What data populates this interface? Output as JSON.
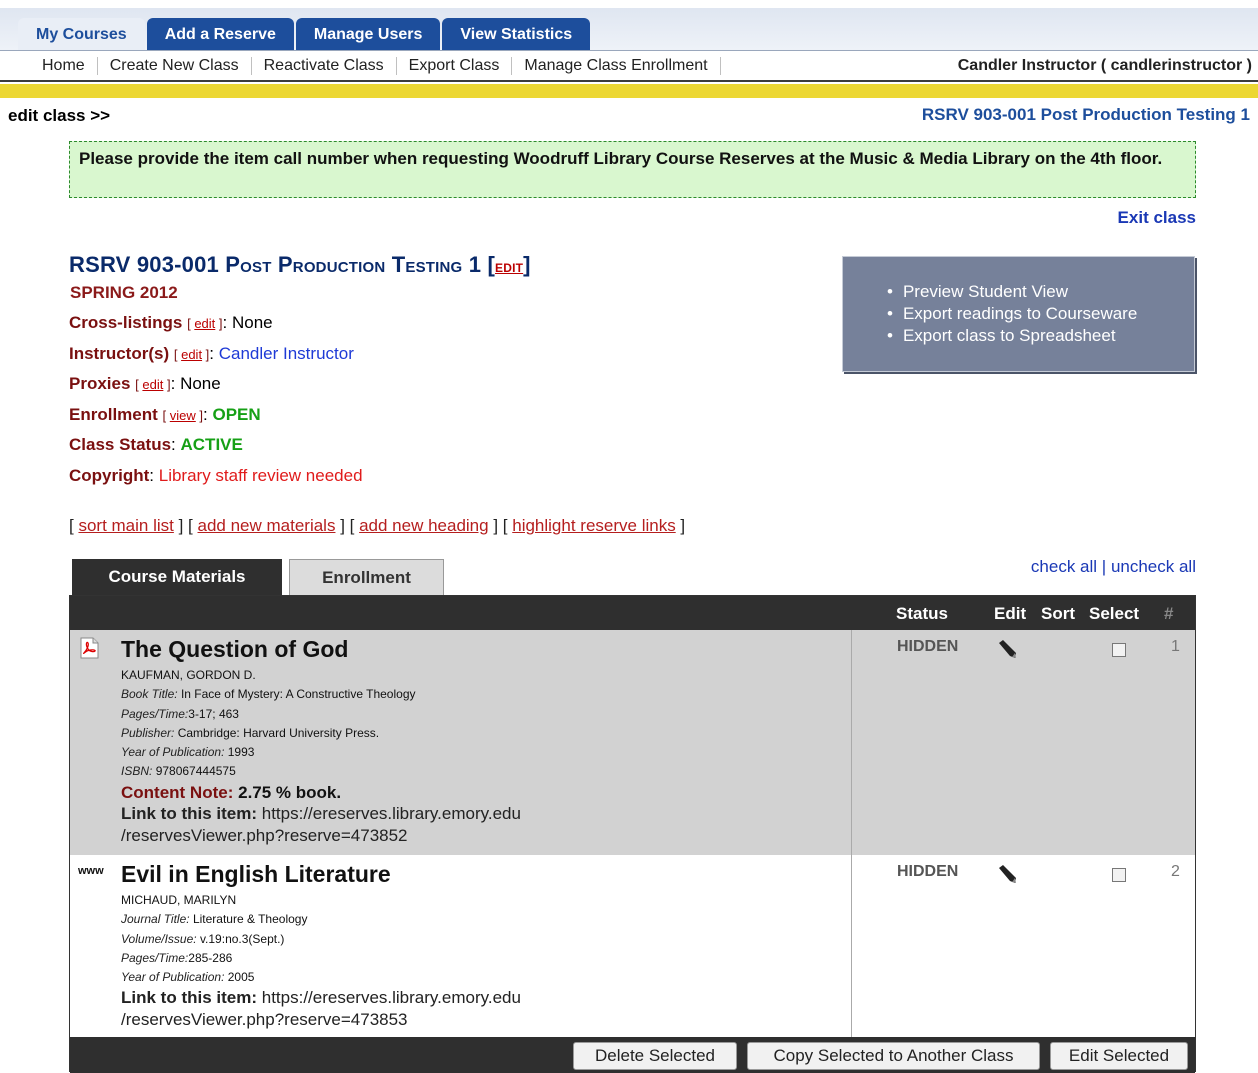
{
  "top_tabs": [
    "My Courses",
    "Add a Reserve",
    "Manage Users",
    "View Statistics"
  ],
  "subnav": [
    "Home",
    "Create New Class",
    "Reactivate Class",
    "Export Class",
    "Manage Class Enrollment"
  ],
  "user": "Candler Instructor ( candlerinstructor )",
  "breadcrumb": "edit class >>",
  "class_header_right": "RSRV 903-001 Post Production Testing 1",
  "notice": "Please provide the item call number when requesting Woodruff Library Course Reserves at the Music & Media Library on the 4th floor.",
  "exit_label": "Exit class",
  "course": {
    "title": "RSRV 903-001 Post Production Testing 1",
    "edit_bracket_open": "[",
    "edit_label": "EDIT",
    "edit_bracket_close": "]",
    "term": "SPRING 2012",
    "crosslistings_label": "Cross-listings",
    "crosslistings_edit": "edit",
    "crosslistings_value": "None",
    "instructors_label": "Instructor(s)",
    "instructors_edit": "edit",
    "instructors_value": "Candler Instructor",
    "proxies_label": "Proxies",
    "proxies_edit": "edit",
    "proxies_value": "None",
    "enrollment_label": "Enrollment",
    "enrollment_view": "view",
    "enrollment_value": "OPEN",
    "status_label": "Class Status",
    "status_value": "ACTIVE",
    "copyright_label": "Copyright",
    "copyright_value": "Library staff review needed"
  },
  "sidebox": [
    "Preview Student View",
    "Export readings to Courseware",
    "Export class to Spreadsheet"
  ],
  "actions": [
    "sort main list",
    "add new materials",
    "add new heading",
    "highlight reserve links"
  ],
  "check_all": "check all",
  "uncheck_all": "uncheck all",
  "tabs": [
    "Course Materials",
    "Enrollment"
  ],
  "columns": {
    "status": "Status",
    "edit": "Edit",
    "sort": "Sort",
    "select": "Select",
    "num": "#"
  },
  "items": [
    {
      "icon": "pdf-icon",
      "title": "The Question of God",
      "author": "KAUFMAN, GORDON D.",
      "book_title_label": "Book Title:",
      "book_title": "In Face of Mystery: A Constructive Theology",
      "pages_label": "Pages/Time:",
      "pages": "3-17; 463",
      "publisher_label": "Publisher:",
      "publisher": "Cambridge: Harvard University Press.",
      "year_label": "Year of Publication:",
      "year": "1993",
      "isbn_label": "ISBN:",
      "isbn": "978067444575",
      "note_label": "Content Note:",
      "note": "2.75 % book.",
      "link_label": "Link to this item:",
      "link_line1": "https://ereserves.library.emory.edu",
      "link_line2": "/reservesViewer.php?reserve=473852",
      "status": "HIDDEN",
      "num": "1"
    },
    {
      "icon_text": "www",
      "title": "Evil in English Literature",
      "author": "MICHAUD, MARILYN",
      "journal_label": "Journal Title:",
      "journal": "Literature & Theology",
      "volume_label": "Volume/Issue:",
      "volume": "v.19:no.3(Sept.)",
      "pages_label": "Pages/Time:",
      "pages": "285-286",
      "year_label": "Year of Publication:",
      "year": "2005",
      "link_label": "Link to this item:",
      "link_line1": "https://ereserves.library.emory.edu",
      "link_line2": "/reservesViewer.php?reserve=473853",
      "status": "HIDDEN",
      "num": "2"
    }
  ],
  "buttons": [
    "Delete Selected",
    "Copy Selected to Another Class",
    "Edit Selected"
  ]
}
